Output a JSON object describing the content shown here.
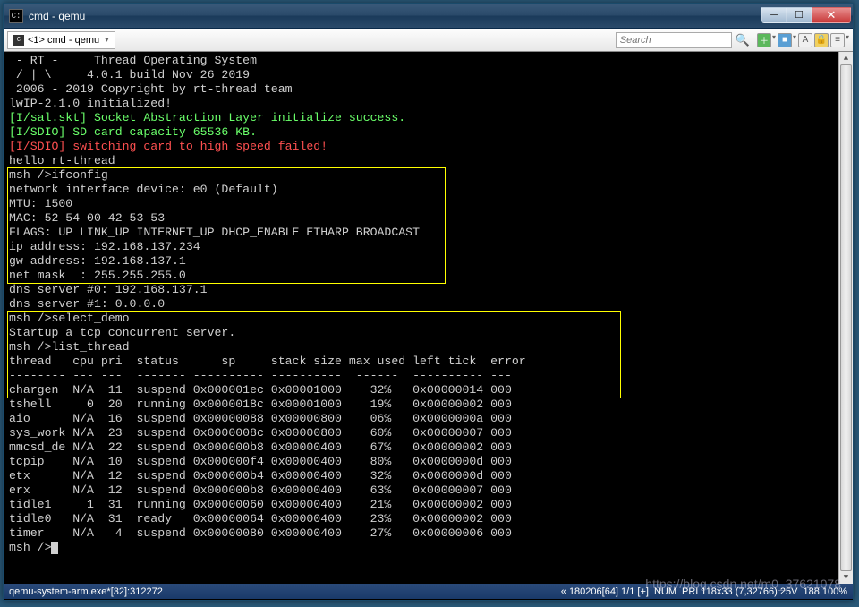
{
  "window": {
    "title": "cmd - qemu"
  },
  "tab": {
    "label": "<1> cmd - qemu"
  },
  "search": {
    "placeholder": "Search"
  },
  "terminal": {
    "banner": [
      " - RT -     Thread Operating System",
      " / | \\     4.0.1 build Nov 26 2019",
      " 2006 - 2019 Copyright by rt-thread team"
    ],
    "lwip": "lwIP-2.1.0 initialized!",
    "sal": "[I/sal.skt] Socket Abstraction Layer initialize success.",
    "sdio1": "[I/SDIO] SD card capacity 65536 KB.",
    "sdio2": "[I/SDIO] switching card to high speed failed!",
    "hello": "hello rt-thread",
    "ifconfig_cmd": "msh />ifconfig",
    "if_device": "network interface device: e0 (Default)",
    "if_mtu": "MTU: 1500",
    "if_mac": "MAC: 52 54 00 42 53 53",
    "if_flags": "FLAGS: UP LINK_UP INTERNET_UP DHCP_ENABLE ETHARP BROADCAST",
    "if_ip": "ip address: 192.168.137.234",
    "if_gw": "gw address: 192.168.137.1",
    "if_mask": "net mask  : 255.255.255.0",
    "dns0": "dns server #0: 192.168.137.1",
    "dns1": "dns server #1: 0.0.0.0",
    "select_cmd": "msh />select_demo",
    "startup": "Startup a tcp concurrent server.",
    "list_cmd": "msh />list_thread",
    "thread_header": "thread   cpu pri  status      sp     stack size max used left tick  error",
    "thread_sep": "-------- --- ---  ------- ---------- ----------  ------  ---------- ---",
    "threads": [
      "chargen  N/A  11  suspend 0x000001ec 0x00001000    32%   0x00000014 000",
      "tshell     0  20  running 0x0000018c 0x00001000    19%   0x00000002 000",
      "aio      N/A  16  suspend 0x00000088 0x00000800    06%   0x0000000a 000",
      "sys_work N/A  23  suspend 0x0000008c 0x00000800    60%   0x00000007 000",
      "mmcsd_de N/A  22  suspend 0x000000b8 0x00000400    67%   0x00000002 000",
      "tcpip    N/A  10  suspend 0x000000f4 0x00000400    80%   0x0000000d 000",
      "etx      N/A  12  suspend 0x000000b4 0x00000400    32%   0x0000000d 000",
      "erx      N/A  12  suspend 0x000000b8 0x00000400    63%   0x00000007 000",
      "tidle1     1  31  running 0x00000060 0x00000400    21%   0x00000002 000",
      "tidle0   N/A  31  ready   0x00000064 0x00000400    23%   0x00000002 000",
      "timer    N/A   4  suspend 0x00000080 0x00000400    27%   0x00000006 000"
    ],
    "prompt": "msh />"
  },
  "status": {
    "left": "qemu-system-arm.exe*[32]:312272",
    "pos": "« 180206[64]  1/1  [+]",
    "num": "NUM",
    "pri": "PRI   118x33   (7,32766) 25V",
    "pct": "188  100%"
  },
  "watermark": "https://blog.csdn.net/m0_37621078"
}
